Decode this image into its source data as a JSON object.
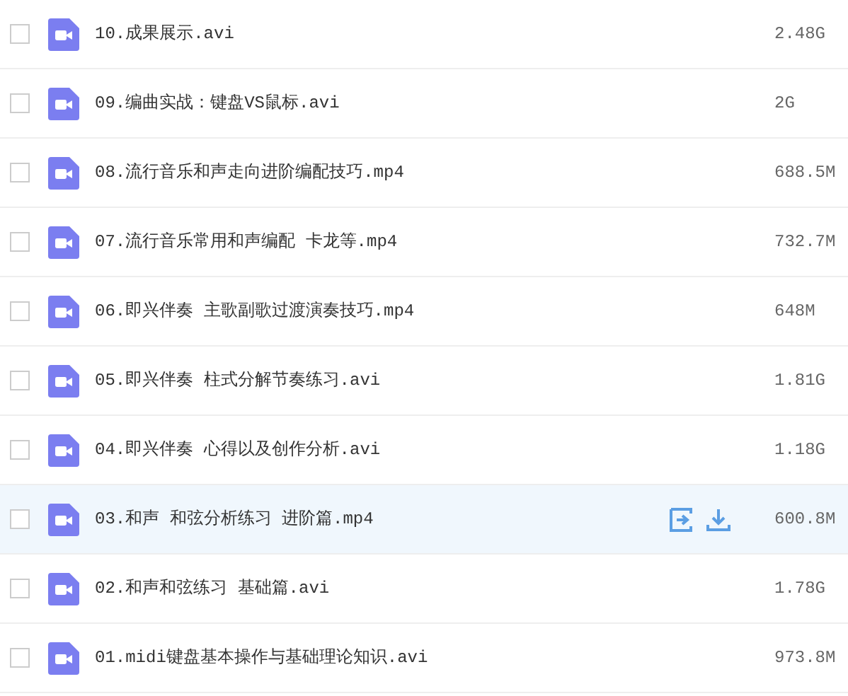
{
  "files": [
    {
      "name": "10.成果展示.avi",
      "size": "2.48G",
      "checked": false,
      "selected": false
    },
    {
      "name": "09.编曲实战：键盘VS鼠标.avi",
      "size": "2G",
      "checked": false,
      "selected": false
    },
    {
      "name": "08.流行音乐和声走向进阶编配技巧.mp4",
      "size": "688.5M",
      "checked": false,
      "selected": false
    },
    {
      "name": "07.流行音乐常用和声编配 卡龙等.mp4",
      "size": "732.7M",
      "checked": false,
      "selected": false
    },
    {
      "name": "06.即兴伴奏 主歌副歌过渡演奏技巧.mp4",
      "size": "648M",
      "checked": false,
      "selected": false
    },
    {
      "name": "05.即兴伴奏 柱式分解节奏练习.avi",
      "size": "1.81G",
      "checked": false,
      "selected": false
    },
    {
      "name": "04.即兴伴奏 心得以及创作分析.avi",
      "size": "1.18G",
      "checked": false,
      "selected": false
    },
    {
      "name": "03.和声 和弦分析练习 进阶篇.mp4",
      "size": "600.8M",
      "checked": false,
      "selected": true
    },
    {
      "name": "02.和声和弦练习 基础篇.avi",
      "size": "1.78G",
      "checked": false,
      "selected": false
    },
    {
      "name": "01.midi键盘基本操作与基础理论知识.avi",
      "size": "973.8M",
      "checked": false,
      "selected": false
    }
  ]
}
